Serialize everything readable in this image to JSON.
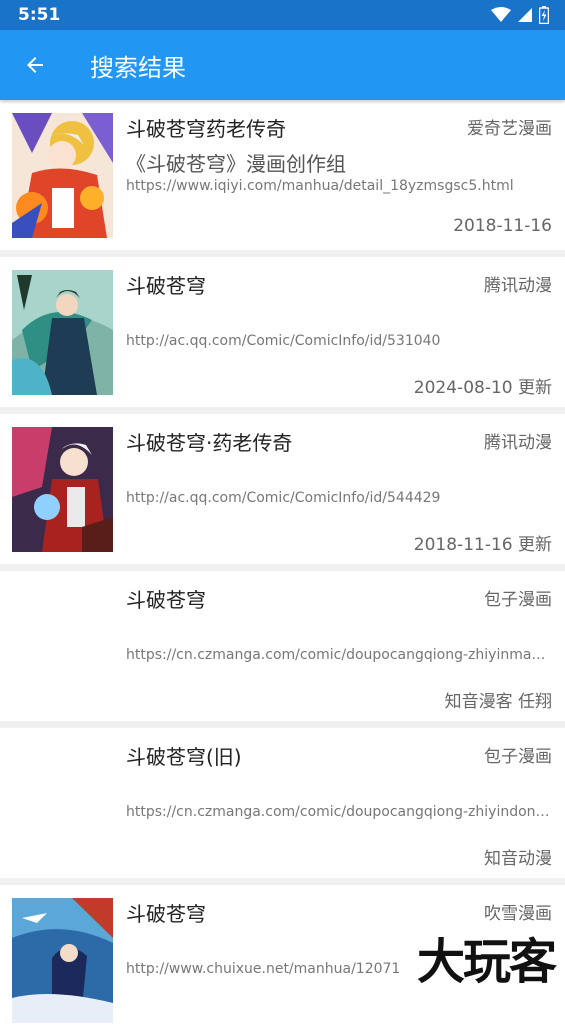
{
  "status_bar": {
    "time": "5:51"
  },
  "app_bar": {
    "title": "搜索结果"
  },
  "results": [
    {
      "title": "斗破苍穹药老传奇",
      "source": "爱奇艺漫画",
      "author": "《斗破苍穹》漫画创作组",
      "url": "https://www.iqiyi.com/manhua/detail_18yzmsgsc5.html",
      "date": "2018-11-16"
    },
    {
      "title": "斗破苍穹",
      "source": "腾讯动漫",
      "author": "",
      "url": "http://ac.qq.com/Comic/ComicInfo/id/531040",
      "date": "2024-08-10 更新"
    },
    {
      "title": "斗破苍穹·药老传奇",
      "source": "腾讯动漫",
      "author": "",
      "url": "http://ac.qq.com/Comic/ComicInfo/id/544429",
      "date": "2018-11-16 更新"
    },
    {
      "title": "斗破苍穹",
      "source": "包子漫画",
      "author": "",
      "url": "https://cn.czmanga.com/comic/doupocangqiong-zhiyinmank...",
      "date": "知音漫客 任翔"
    },
    {
      "title": "斗破苍穹(旧)",
      "source": "包子漫画",
      "author": "",
      "url": "https://cn.czmanga.com/comic/doupocangqiong-zhiyindong...",
      "date": "知音动漫"
    },
    {
      "title": "斗破苍穹",
      "source": "吹雪漫画",
      "author": "",
      "url": "http://www.chuixue.net/manhua/12071",
      "date": ""
    }
  ],
  "watermark": "大玩客"
}
